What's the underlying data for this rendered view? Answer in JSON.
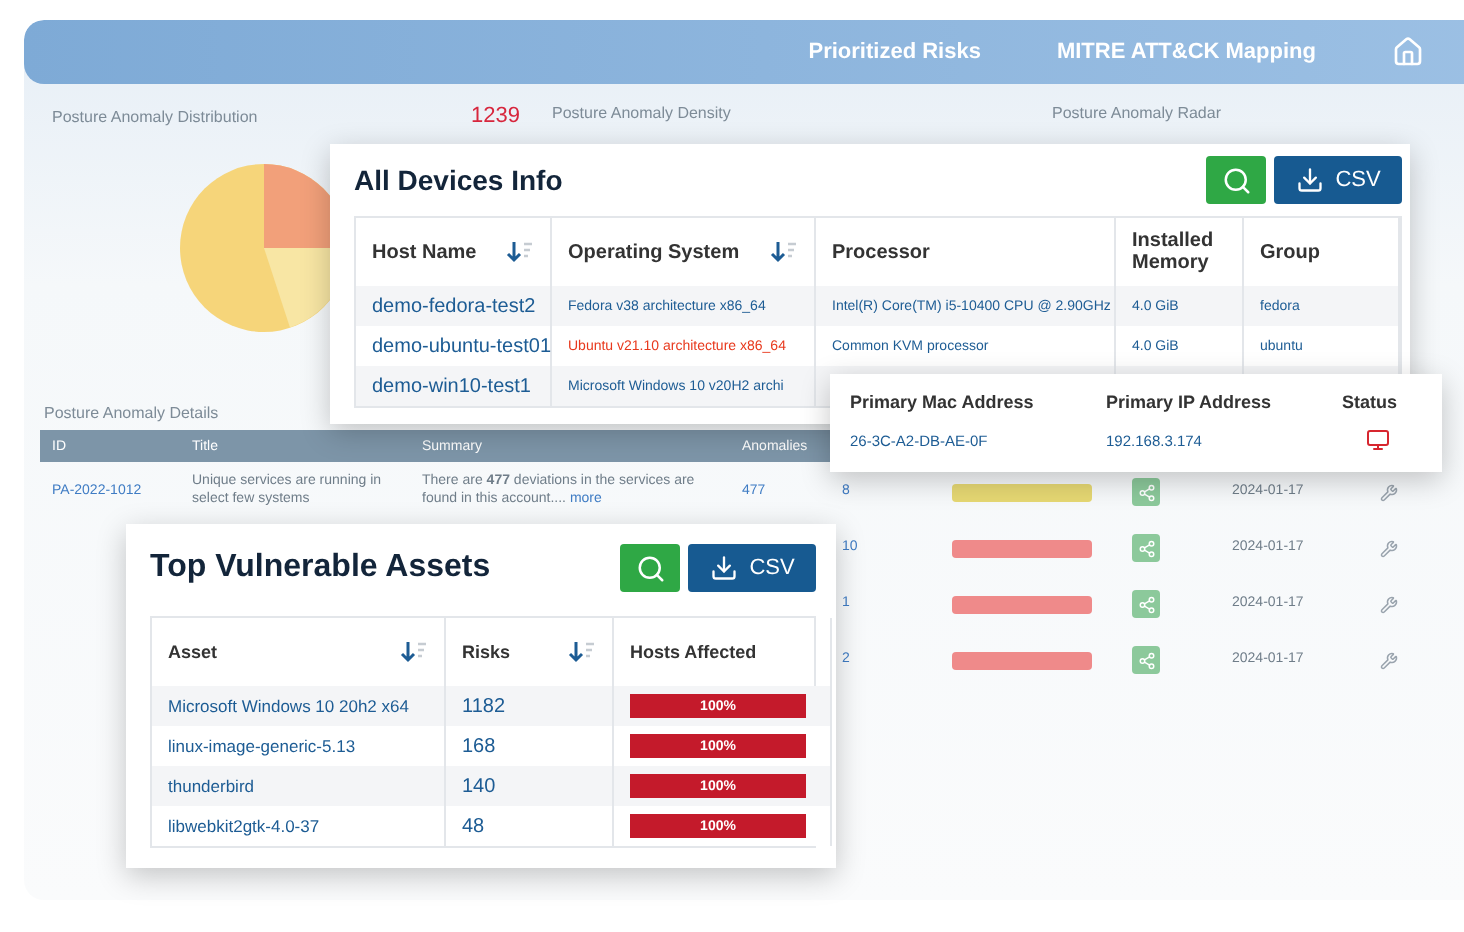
{
  "dashboard": {
    "nav": [
      "Prioritized Risks",
      "MITRE ATT&CK Mapping"
    ],
    "panels": [
      {
        "title": "Posture Anomaly Distribution",
        "count": "1239"
      },
      {
        "title": "Posture Anomaly Density"
      },
      {
        "title": "Posture Anomaly Radar"
      }
    ],
    "details": {
      "title": "Posture Anomaly Details",
      "columns": [
        "ID",
        "Title",
        "Summary",
        "Anomalies"
      ],
      "first_row": {
        "id": "PA-2022-1012",
        "title": "Unique services are running in select few systems",
        "summary": "There are **477** deviations in the services are found in this account....",
        "more": "more",
        "anomalies": "477"
      },
      "rows": [
        {
          "count": "8",
          "color": "#e6d873",
          "date": "2024-01-17"
        },
        {
          "count": "10",
          "color": "#ef8a8a",
          "date": "2024-01-17"
        },
        {
          "count": "1",
          "color": "#ef8a8a",
          "date": "2024-01-17"
        },
        {
          "count": "2",
          "color": "#ef8a8a",
          "date": "2024-01-17"
        }
      ]
    }
  },
  "devices": {
    "title": "All Devices Info",
    "csv": "CSV",
    "columns": [
      {
        "label": "Host Name",
        "sortable": true
      },
      {
        "label": "Operating System",
        "sortable": true
      },
      {
        "label": "Processor",
        "sortable": false
      },
      {
        "label": "Installed Memory",
        "sortable": false
      },
      {
        "label": "Group",
        "sortable": false
      }
    ],
    "rows": [
      {
        "host": "demo-fedora-test2",
        "os": "Fedora v38 architecture x86_64",
        "color": "#1d5c94",
        "processor": "Intel(R) Core(TM) i5-10400 CPU @ 2.90GHz",
        "memory": "4.0 GiB",
        "group": "fedora"
      },
      {
        "host": "demo-ubuntu-test01",
        "os": "Ubuntu v21.10 architecture x86_64",
        "color": "#e8391d",
        "processor": "Common KVM processor",
        "memory": "4.0 GiB",
        "group": "ubuntu"
      },
      {
        "host": "demo-win10-test1",
        "os": "Microsoft Windows 10 v20H2 archi",
        "color": "#1d5c94"
      }
    ]
  },
  "device_detail": {
    "columns": [
      "Primary Mac Address",
      "Primary IP Address",
      "Status"
    ],
    "row": {
      "mac": "26-3C-A2-DB-AE-0F",
      "ip": "192.168.3.174",
      "status": {
        "color": "#d7262f"
      }
    }
  },
  "assets": {
    "title": "Top Vulnerable Assets",
    "csv": "CSV",
    "columns": [
      {
        "label": "Asset",
        "sortable": true
      },
      {
        "label": "Risks",
        "sortable": true
      },
      {
        "label": "Hosts Affected",
        "sortable": false
      }
    ],
    "rows": [
      {
        "asset": "Microsoft Windows 10 20h2 x64",
        "risks": "1182",
        "hosts": "100%",
        "level": 1
      },
      {
        "asset": "linux-image-generic-5.13",
        "risks": "168",
        "hosts": "100%",
        "level": 1
      },
      {
        "asset": "thunderbird",
        "risks": "140",
        "hosts": "100%",
        "level": 1
      },
      {
        "asset": "libwebkit2gtk-4.0-37",
        "risks": "48",
        "hosts": "100%",
        "level": 1
      }
    ]
  }
}
